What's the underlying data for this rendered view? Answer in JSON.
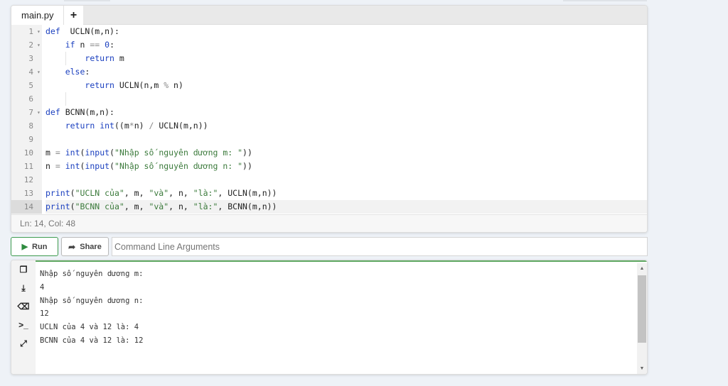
{
  "editor": {
    "tabs": [
      {
        "label": "main.py"
      },
      {
        "label": "+"
      }
    ],
    "lines": [
      {
        "n": "1",
        "fold": true,
        "tokens": [
          [
            "kw",
            "def"
          ],
          [
            "",
            "  UCLN(m,n):"
          ]
        ]
      },
      {
        "n": "2",
        "fold": true,
        "tokens": [
          [
            "",
            "    "
          ],
          [
            "kw",
            "if"
          ],
          [
            "",
            " n "
          ],
          [
            "op",
            "=="
          ],
          [
            "",
            " "
          ],
          [
            "num",
            "0"
          ],
          [
            "",
            ":"
          ]
        ]
      },
      {
        "n": "3",
        "fold": false,
        "tokens": [
          [
            "",
            "        "
          ],
          [
            "kw",
            "return"
          ],
          [
            "",
            " m"
          ]
        ]
      },
      {
        "n": "4",
        "fold": true,
        "tokens": [
          [
            "",
            "    "
          ],
          [
            "kw",
            "else"
          ],
          [
            "",
            ":"
          ]
        ]
      },
      {
        "n": "5",
        "fold": false,
        "tokens": [
          [
            "",
            "        "
          ],
          [
            "kw",
            "return"
          ],
          [
            "",
            " UCLN(n,m "
          ],
          [
            "op",
            "%"
          ],
          [
            "",
            " n)"
          ]
        ]
      },
      {
        "n": "6",
        "fold": false,
        "tokens": []
      },
      {
        "n": "7",
        "fold": true,
        "tokens": [
          [
            "kw",
            "def"
          ],
          [
            "",
            " BCNN(m,n):"
          ]
        ]
      },
      {
        "n": "8",
        "fold": false,
        "tokens": [
          [
            "",
            "    "
          ],
          [
            "kw",
            "return"
          ],
          [
            "",
            " "
          ],
          [
            "bi",
            "int"
          ],
          [
            "",
            "((m"
          ],
          [
            "op",
            "*"
          ],
          [
            "",
            "n) "
          ],
          [
            "op",
            "/"
          ],
          [
            "",
            " UCLN(m,n))"
          ]
        ]
      },
      {
        "n": "9",
        "fold": false,
        "tokens": []
      },
      {
        "n": "10",
        "fold": false,
        "tokens": [
          [
            "",
            "m "
          ],
          [
            "op",
            "="
          ],
          [
            "",
            " "
          ],
          [
            "bi",
            "int"
          ],
          [
            "",
            "("
          ],
          [
            "bi",
            "input"
          ],
          [
            "",
            "("
          ],
          [
            "str",
            "\"Nhập số nguyên dương m: \""
          ],
          [
            "",
            "))"
          ]
        ]
      },
      {
        "n": "11",
        "fold": false,
        "tokens": [
          [
            "",
            "n "
          ],
          [
            "op",
            "="
          ],
          [
            "",
            " "
          ],
          [
            "bi",
            "int"
          ],
          [
            "",
            "("
          ],
          [
            "bi",
            "input"
          ],
          [
            "",
            "("
          ],
          [
            "str",
            "\"Nhập số nguyên dương n: \""
          ],
          [
            "",
            "))"
          ]
        ]
      },
      {
        "n": "12",
        "fold": false,
        "tokens": []
      },
      {
        "n": "13",
        "fold": false,
        "tokens": [
          [
            "bi",
            "print"
          ],
          [
            "",
            "("
          ],
          [
            "str",
            "\"UCLN của\""
          ],
          [
            "",
            ", m, "
          ],
          [
            "str",
            "\"và\""
          ],
          [
            "",
            ", n, "
          ],
          [
            "str",
            "\"là:\""
          ],
          [
            "",
            ", UCLN(m,n))"
          ]
        ]
      },
      {
        "n": "14",
        "fold": false,
        "current": true,
        "tokens": [
          [
            "bi",
            "print"
          ],
          [
            "",
            "("
          ],
          [
            "str",
            "\"BCNN của\""
          ],
          [
            "",
            ", m, "
          ],
          [
            "str",
            "\"và\""
          ],
          [
            "",
            ", n, "
          ],
          [
            "str",
            "\"là:\""
          ],
          [
            "",
            ", BCNN(m,n))"
          ]
        ]
      }
    ],
    "status": "Ln: 14,  Col: 48"
  },
  "toolbar": {
    "run_label": "Run",
    "share_label": "Share",
    "args_placeholder": "Command Line Arguments"
  },
  "output": {
    "tools": [
      {
        "name": "copy-icon",
        "glyph": "❐"
      },
      {
        "name": "download-icon",
        "glyph": "⤓"
      },
      {
        "name": "eraser-icon",
        "glyph": "⌫"
      },
      {
        "name": "terminal-icon",
        "glyph": ">_"
      },
      {
        "name": "expand-icon",
        "glyph": "⤢"
      }
    ],
    "lines": [
      "Nhập số nguyên dương m:",
      "4",
      "Nhập số nguyên dương n:",
      "12",
      "UCLN của 4 và 12 là: 4",
      "BCNN của 4 và 12 là: 12"
    ]
  },
  "colors": {
    "accent": "#3c9a4e",
    "keyword": "#1a3fbf",
    "string": "#3b7a3b"
  }
}
